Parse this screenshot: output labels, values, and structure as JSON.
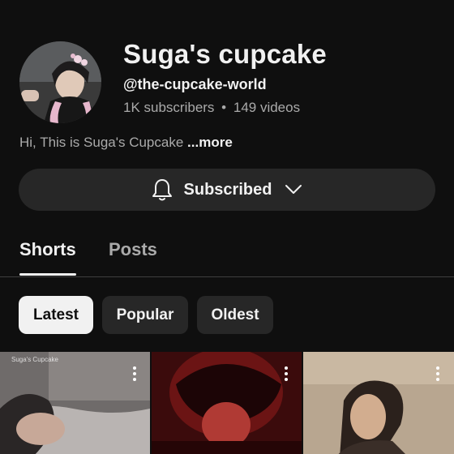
{
  "channel": {
    "name": "Suga's cupcake",
    "handle": "@the-cupcake-world",
    "subscribers": "1K subscribers",
    "separator": "•",
    "videos": "149 videos",
    "description": "Hi, This is Suga's Cupcake ",
    "more_label": "...more"
  },
  "subscribe_button": {
    "label": "Subscribed",
    "icon": "bell-icon"
  },
  "tabs": [
    {
      "label": "Shorts",
      "active": true
    },
    {
      "label": "Posts",
      "active": false
    }
  ],
  "filters": [
    {
      "label": "Latest",
      "selected": true
    },
    {
      "label": "Popular",
      "selected": false
    },
    {
      "label": "Oldest",
      "selected": false
    }
  ],
  "shorts": [
    {
      "overlay_text": "Suga's Cupcake"
    },
    {
      "overlay_text": ""
    },
    {
      "overlay_text": ""
    }
  ],
  "colors": {
    "background": "#0f0f0f",
    "button_bg": "#272727",
    "text_primary": "#f1f1f1",
    "text_secondary": "#aaaaaa",
    "chip_selected": "#f1f1f1"
  }
}
